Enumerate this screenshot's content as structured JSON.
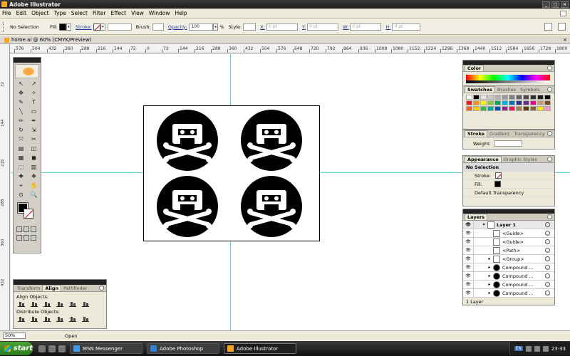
{
  "app": {
    "title": "Adobe Illustrator",
    "window_buttons": [
      "_",
      "□",
      "×"
    ]
  },
  "menu": [
    "File",
    "Edit",
    "Object",
    "Type",
    "Select",
    "Filter",
    "Effect",
    "View",
    "Window",
    "Help"
  ],
  "control_bar": {
    "selection": "No Selection",
    "fill_label": "Fill:",
    "stroke_label": "Stroke:",
    "brush_label": "Brush:",
    "opacity_label": "Opacity:",
    "opacity_value": "100",
    "percent": "%",
    "style_label": "Style:",
    "x_label": "X:",
    "x_value": "0 pt",
    "y_label": "Y:",
    "y_value": "0 pt",
    "w_label": "W:",
    "w_value": "0 pt",
    "h_label": "H:",
    "h_value": "0 pt"
  },
  "document": {
    "tab_title": "home.ai @ 60% (CMYK/Preview)",
    "close": "×",
    "ruler_labels": [
      "576",
      "504",
      "432",
      "360",
      "288",
      "216",
      "144",
      "72",
      "0",
      "72",
      "144",
      "216",
      "288",
      "360",
      "432",
      "504",
      "576",
      "648",
      "720",
      "792",
      "864",
      "936",
      "1008",
      "1080",
      "1152",
      "1224",
      "1296",
      "1368",
      "1440",
      "1512",
      "1584",
      "1656",
      "1728",
      "1800"
    ],
    "vruler_labels": [
      "72",
      "144",
      "216",
      "288",
      "360",
      "432"
    ]
  },
  "tools": [
    "↖",
    "↗",
    "✥",
    "✧",
    "✎",
    "T",
    "╲",
    "▭",
    "✏",
    "✒",
    "↻",
    "⇲",
    "⤧",
    "✂",
    "▤",
    "◫",
    "▦",
    "◼",
    "⬚",
    "▥",
    "✚",
    "❖",
    "⌖",
    "✋",
    "⊙",
    "🔍"
  ],
  "align_panel": {
    "tabs": [
      "Transform",
      "Align",
      "Pathfinder"
    ],
    "active_tab": "Align",
    "align_objects": "Align Objects:",
    "distribute_objects": "Distribute Objects:"
  },
  "color_panel": {
    "tabs": [
      "Color"
    ]
  },
  "swatch_panel": {
    "tabs": [
      "Swatches",
      "Brushes",
      "Symbols"
    ],
    "colors": [
      "#ffffff",
      "#000000",
      "#e6e6e6",
      "#cccccc",
      "#b3b3b3",
      "#999999",
      "#808080",
      "#666666",
      "#4d4d4d",
      "#333333",
      "#1a1a1a",
      "#000000",
      "#ed1c24",
      "#f7941d",
      "#fff200",
      "#8dc63f",
      "#00a651",
      "#00aeef",
      "#0072bc",
      "#2e3192",
      "#662d91",
      "#ec008c",
      "#c69c6d",
      "#754c24",
      "#f26522",
      "#ffcc00",
      "#39b54a",
      "#00a99d",
      "#0054a6",
      "#92278f",
      "#ee145b",
      "#a67c52",
      "#603913",
      "#8b5e3c",
      "#ffe600",
      "#f49ac2"
    ]
  },
  "stroke_panel": {
    "tabs": [
      "Stroke",
      "Gradient",
      "Transparency"
    ],
    "weight_label": "Weight:"
  },
  "appearance_panel": {
    "tabs": [
      "Appearance",
      "Graphic Styles"
    ],
    "rows": [
      "No Selection",
      "Stroke:",
      "Fill:",
      "Default Transparency"
    ]
  },
  "layers_panel": {
    "tab": "Layers",
    "rows": [
      "Layer 1",
      "<Guide>",
      "<Guide>",
      "<Path>",
      "<Group>",
      "Compound ...",
      "Compound ...",
      "Compound ...",
      "Compound ..."
    ],
    "footer": "1 Layer"
  },
  "status": {
    "zoom": "50%",
    "state": "Open"
  },
  "taskbar": {
    "start": "start",
    "tasks": [
      "MSN Messenger",
      "Adobe Photoshop",
      "Adobe Illustrator"
    ],
    "active_task": "Adobe Illustrator",
    "tray_tag": "EN",
    "clock": "23:33"
  }
}
